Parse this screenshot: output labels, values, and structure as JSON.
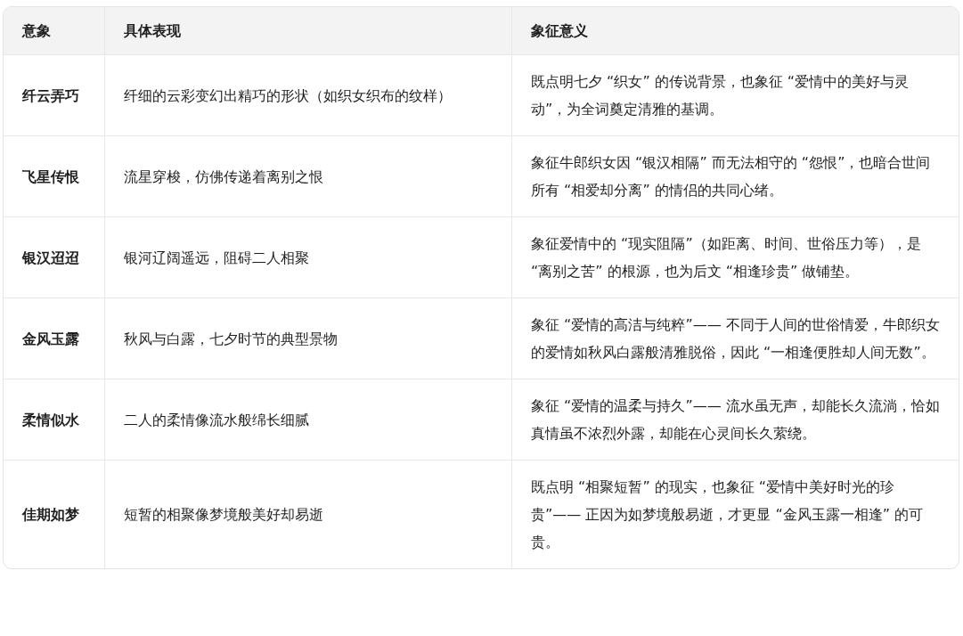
{
  "table": {
    "columns": [
      "意象",
      "具体表现",
      "象征意义"
    ],
    "rows": [
      {
        "image": "纤云弄巧",
        "depiction": "纤细的云彩变幻出精巧的形状（如织女织布的纹样）",
        "meaning": "既点明七夕 “织女” 的传说背景，也象征 “爱情中的美好与灵动”，为全词奠定清雅的基调。"
      },
      {
        "image": "飞星传恨",
        "depiction": "流星穿梭，仿佛传递着离别之恨",
        "meaning": "象征牛郎织女因 “银汉相隔” 而无法相守的 “怨恨”，也暗合世间所有 “相爱却分离” 的情侣的共同心绪。"
      },
      {
        "image": "银汉迢迢",
        "depiction": "银河辽阔遥远，阻碍二人相聚",
        "meaning": "象征爱情中的 “现实阻隔”（如距离、时间、世俗压力等），是 “离别之苦” 的根源，也为后文 “相逢珍贵” 做铺垫。"
      },
      {
        "image": "金风玉露",
        "depiction": "秋风与白露，七夕时节的典型景物",
        "meaning": "象征 “爱情的高洁与纯粹”—— 不同于人间的世俗情爱，牛郎织女的爱情如秋风白露般清雅脱俗，因此 “一相逢便胜却人间无数”。"
      },
      {
        "image": "柔情似水",
        "depiction": "二人的柔情像流水般绵长细腻",
        "meaning": "象征 “爱情的温柔与持久”—— 流水虽无声，却能长久流淌，恰如真情虽不浓烈外露，却能在心灵间长久萦绕。"
      },
      {
        "image": "佳期如梦",
        "depiction": "短暂的相聚像梦境般美好却易逝",
        "meaning": "既点明 “相聚短暂” 的现实，也象征 “爱情中美好时光的珍贵”—— 正因为如梦境般易逝，才更显 “金风玉露一相逢” 的可贵。"
      }
    ]
  }
}
